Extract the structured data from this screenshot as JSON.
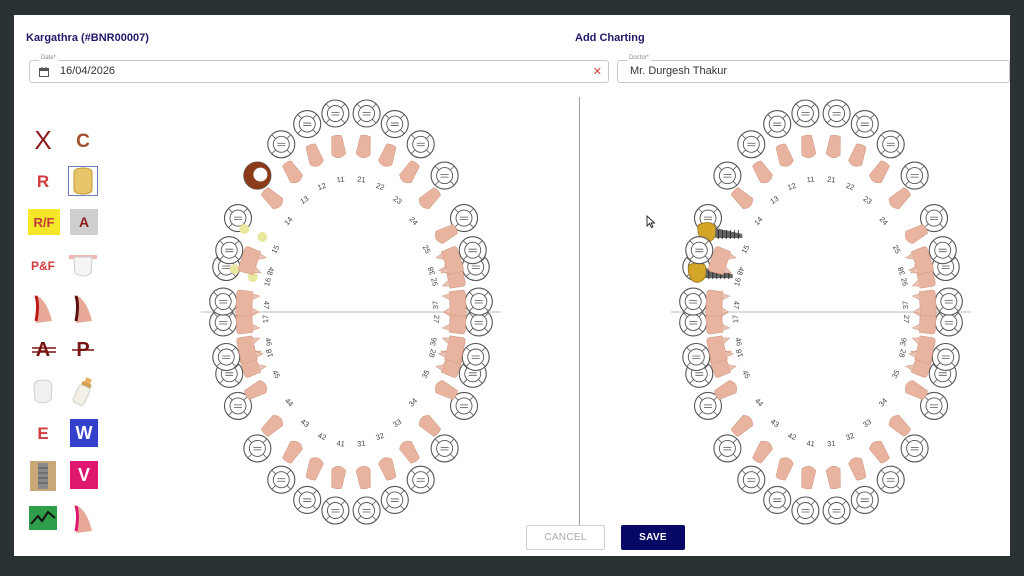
{
  "header": {
    "patient": "Kargathra (#BNR00007)",
    "title": "Add Charting"
  },
  "date_field": {
    "label": "Date*",
    "value": "16/04/2026",
    "clear_glyph": "✕"
  },
  "doctor_field": {
    "label": "Doctor*",
    "value": "Mr. Durgesh Thakur"
  },
  "tools": [
    {
      "key": "missing",
      "text": "X",
      "color": "#8b1a1a"
    },
    {
      "key": "crown",
      "text": "C",
      "color": "#a0522d"
    },
    {
      "key": "root-canal",
      "text": "R",
      "color": "#d23c3c"
    },
    {
      "key": "gold-crown",
      "icon": "gold-crown-icon"
    },
    {
      "key": "root-fill",
      "text": "R/F",
      "color": "#c23a3a",
      "bg": "#f4e72a"
    },
    {
      "key": "abscess",
      "text": "A",
      "color": "#8b1a1a",
      "bg": "#cfcfcf"
    },
    {
      "key": "post-fill",
      "text": "P&F",
      "color": "#d23c3c"
    },
    {
      "key": "veneer",
      "icon": "veneer-icon"
    },
    {
      "key": "root-red",
      "icon": "root-canal-red-icon"
    },
    {
      "key": "root-dark",
      "icon": "root-canal-dark-icon"
    },
    {
      "key": "a-strike",
      "text": "A",
      "color": "#7a1414"
    },
    {
      "key": "p-strike",
      "text": "P",
      "color": "#7a1414"
    },
    {
      "key": "white-tooth",
      "icon": "white-tooth-icon"
    },
    {
      "key": "milk-bottle",
      "icon": "milk-bottle-icon"
    },
    {
      "key": "extract",
      "text": "E",
      "color": "#d23c3c"
    },
    {
      "key": "w",
      "text": "W",
      "color": "#ffffff",
      "bg": "#3340cc"
    },
    {
      "key": "implant",
      "icon": "implant-icon"
    },
    {
      "key": "v",
      "text": "V",
      "color": "#ffffff",
      "bg": "#e0176f"
    },
    {
      "key": "fracture",
      "icon": "fracture-icon"
    },
    {
      "key": "root-pink",
      "icon": "root-canal-pink-icon"
    }
  ],
  "tooth_numbers": {
    "upper_right": [
      "11",
      "12",
      "13",
      "14",
      "15",
      "16",
      "17",
      "18"
    ],
    "upper_left": [
      "21",
      "22",
      "23",
      "24",
      "25",
      "26",
      "27",
      "28"
    ],
    "lower_left": [
      "31",
      "32",
      "33",
      "34",
      "35",
      "36",
      "37",
      "38"
    ],
    "lower_right": [
      "41",
      "42",
      "43",
      "44",
      "45",
      "46",
      "47",
      "48"
    ]
  },
  "buttons": {
    "cancel": "CANCEL",
    "save": "SAVE"
  },
  "colors": {
    "brand_navy": "#070866",
    "tooth_pink": "#e8b4a0",
    "gold": "#d4a628",
    "caries_brown": "#8b3a1a",
    "marker_yellow": "#e8e8a0"
  }
}
